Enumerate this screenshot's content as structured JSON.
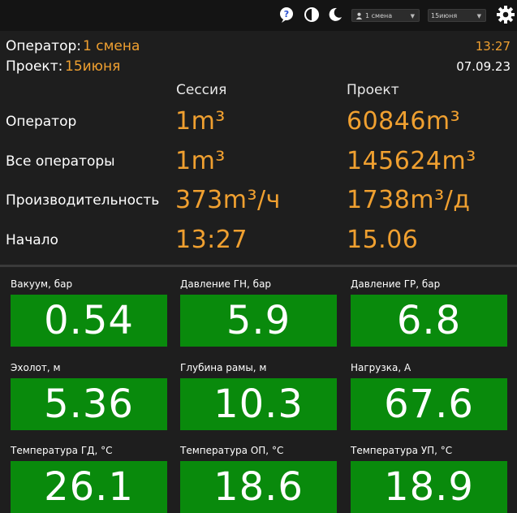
{
  "toolbar": {
    "icons": [
      "help-icon",
      "contrast-icon",
      "moon-icon",
      "gear-icon"
    ],
    "shift_select": "1 смена",
    "project_select": "15июня"
  },
  "header": {
    "operator_label": "Оператор:",
    "operator_value": "1 смена",
    "project_label": "Проект:",
    "project_value": "15июня",
    "time": "13:27",
    "date": "07.09.23"
  },
  "stats": {
    "col_session": "Сессия",
    "col_project": "Проект",
    "rows": [
      {
        "label": "Оператор",
        "session": "1m³",
        "project": "60846m³"
      },
      {
        "label": "Все операторы",
        "session": "1m³",
        "project": "145624m³"
      },
      {
        "label": "Производительность",
        "session": "373m³/ч",
        "project": "1738m³/д"
      },
      {
        "label": "Начало",
        "session": "13:27",
        "project": "15.06"
      }
    ]
  },
  "gauges": [
    {
      "label": "Вакуум, бар",
      "value": "0.54"
    },
    {
      "label": "Давление ГН, бар",
      "value": "5.9"
    },
    {
      "label": "Давление ГР, бар",
      "value": "6.8"
    },
    {
      "label": "Эхолот, м",
      "value": "5.36"
    },
    {
      "label": "Глубина рамы, м",
      "value": "10.3"
    },
    {
      "label": "Нагрузка, А",
      "value": "67.6"
    },
    {
      "label": "Температура ГД, °С",
      "value": "26.1"
    },
    {
      "label": "Температура ОП, °С",
      "value": "18.6"
    },
    {
      "label": "Температура УП, °С",
      "value": "18.9"
    }
  ],
  "colors": {
    "accent": "#f0a030",
    "gauge_bg": "#098a0c",
    "background": "#1e1e1e"
  }
}
